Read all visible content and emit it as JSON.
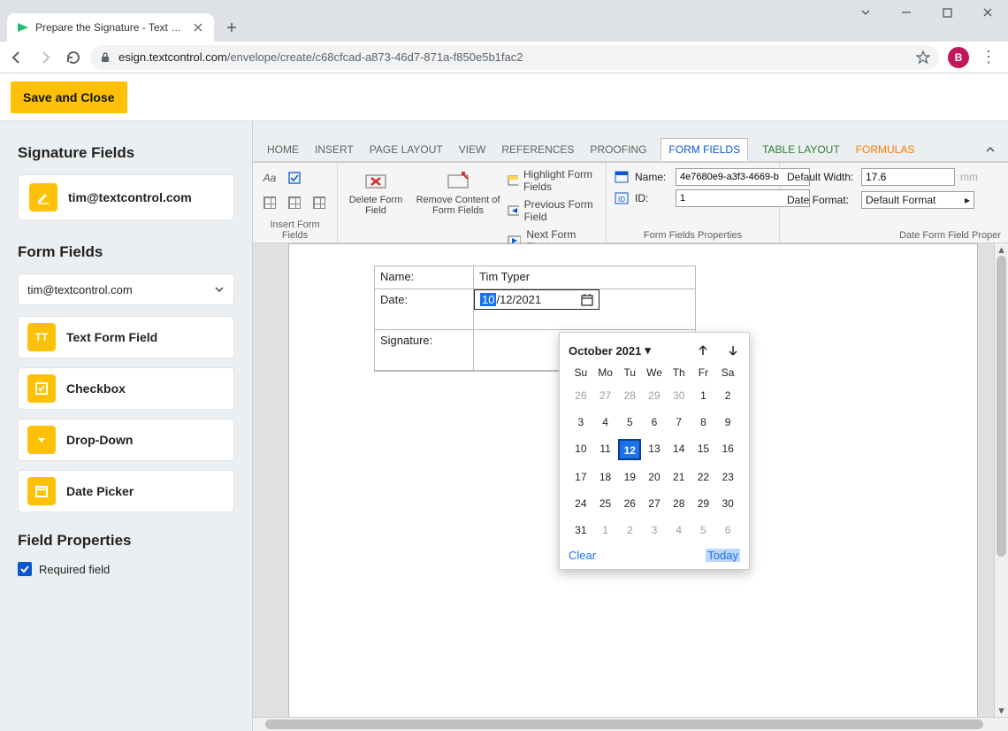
{
  "browser": {
    "tab_title": "Prepare the Signature - Text Con",
    "url_domain": "esign.textcontrol.com",
    "url_path": "/envelope/create/c68cfcad-a873-46d7-871a-f850e5b1fac2",
    "profile_initial": "B"
  },
  "app": {
    "save_close": "Save and Close"
  },
  "sidebar": {
    "sig_fields_title": "Signature Fields",
    "sig_email": "tim@textcontrol.com",
    "form_fields_title": "Form Fields",
    "select_signer": "tim@textcontrol.com",
    "fields": [
      {
        "label": "Text Form Field"
      },
      {
        "label": "Checkbox"
      },
      {
        "label": "Drop-Down"
      },
      {
        "label": "Date Picker"
      }
    ],
    "prop_title": "Field Properties",
    "required_label": "Required field"
  },
  "ribbon": {
    "tabs": {
      "home": "HOME",
      "insert": "INSERT",
      "page_layout": "PAGE LAYOUT",
      "view": "VIEW",
      "references": "REFERENCES",
      "proofing": "PROOFING",
      "form_fields": "FORM FIELDS",
      "table_layout": "TABLE LAYOUT",
      "formulas": "FORMULAS"
    },
    "groups": {
      "insert": "Insert Form Fields",
      "edit": "Edit Form Fields",
      "props": "Form Fields Properties",
      "date": "Date Form Field Proper"
    },
    "edit": {
      "delete": "Delete Form Field",
      "remove": "Remove Content of Form Fields",
      "highlight": "Highlight Form Fields",
      "previous": "Previous Form Field",
      "next": "Next Form Field"
    },
    "props": {
      "name_label": "Name:",
      "name_value": "4e7680e9-a3f3-4669-b",
      "id_label": "ID:",
      "id_value": "1"
    },
    "date": {
      "width_label": "Default Width:",
      "width_value": "17.6",
      "width_unit": "mm",
      "format_label": "Date Format:",
      "format_value": "Default Format"
    }
  },
  "document": {
    "name_label": "Name:",
    "name_value": "Tim Typer",
    "date_label": "Date:",
    "date_month": "10",
    "date_rest": "/12/2021",
    "signature_label": "Signature:"
  },
  "datepicker": {
    "month_label": "October 2021",
    "dow": [
      "Su",
      "Mo",
      "Tu",
      "We",
      "Th",
      "Fr",
      "Sa"
    ],
    "weeks": [
      [
        {
          "n": "26",
          "m": true
        },
        {
          "n": "27",
          "m": true
        },
        {
          "n": "28",
          "m": true
        },
        {
          "n": "29",
          "m": true
        },
        {
          "n": "30",
          "m": true
        },
        {
          "n": "1"
        },
        {
          "n": "2"
        }
      ],
      [
        {
          "n": "3"
        },
        {
          "n": "4"
        },
        {
          "n": "5"
        },
        {
          "n": "6"
        },
        {
          "n": "7"
        },
        {
          "n": "8"
        },
        {
          "n": "9"
        }
      ],
      [
        {
          "n": "10"
        },
        {
          "n": "11"
        },
        {
          "n": "12",
          "sel": true
        },
        {
          "n": "13"
        },
        {
          "n": "14"
        },
        {
          "n": "15"
        },
        {
          "n": "16"
        }
      ],
      [
        {
          "n": "17"
        },
        {
          "n": "18"
        },
        {
          "n": "19"
        },
        {
          "n": "20"
        },
        {
          "n": "21"
        },
        {
          "n": "22"
        },
        {
          "n": "23"
        }
      ],
      [
        {
          "n": "24"
        },
        {
          "n": "25"
        },
        {
          "n": "26"
        },
        {
          "n": "27"
        },
        {
          "n": "28"
        },
        {
          "n": "29"
        },
        {
          "n": "30"
        }
      ],
      [
        {
          "n": "31"
        },
        {
          "n": "1",
          "m": true
        },
        {
          "n": "2",
          "m": true
        },
        {
          "n": "3",
          "m": true
        },
        {
          "n": "4",
          "m": true
        },
        {
          "n": "5",
          "m": true
        },
        {
          "n": "6",
          "m": true
        }
      ]
    ],
    "clear": "Clear",
    "today": "Today"
  }
}
